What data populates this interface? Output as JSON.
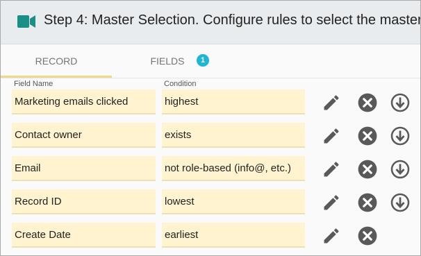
{
  "header": {
    "title": "Step 4: Master Selection. Configure rules to select the master"
  },
  "tabs": [
    {
      "label": "RECORD",
      "active": true
    },
    {
      "label": "FIELDS",
      "badge": "1"
    }
  ],
  "columns": {
    "field": "Field Name",
    "condition": "Condition"
  },
  "rows": [
    {
      "field": "Marketing emails clicked",
      "condition": "highest"
    },
    {
      "field": "Contact owner",
      "condition": "exists"
    },
    {
      "field": "Email",
      "condition": "not role-based (info@, etc.)"
    },
    {
      "field": "Record ID",
      "condition": "lowest"
    },
    {
      "field": "Create Date",
      "condition": "earliest"
    }
  ],
  "icons": {
    "header": "video-camera-icon",
    "row_actions": [
      "pencil-icon",
      "close-circle-icon",
      "arrow-down-circle-icon"
    ]
  },
  "colors": {
    "accent": "#1a8f86",
    "badge": "#1eb7d3",
    "field_bg": "#fff4cf",
    "tab_underline": "#f2d788",
    "icon": "#595959"
  }
}
